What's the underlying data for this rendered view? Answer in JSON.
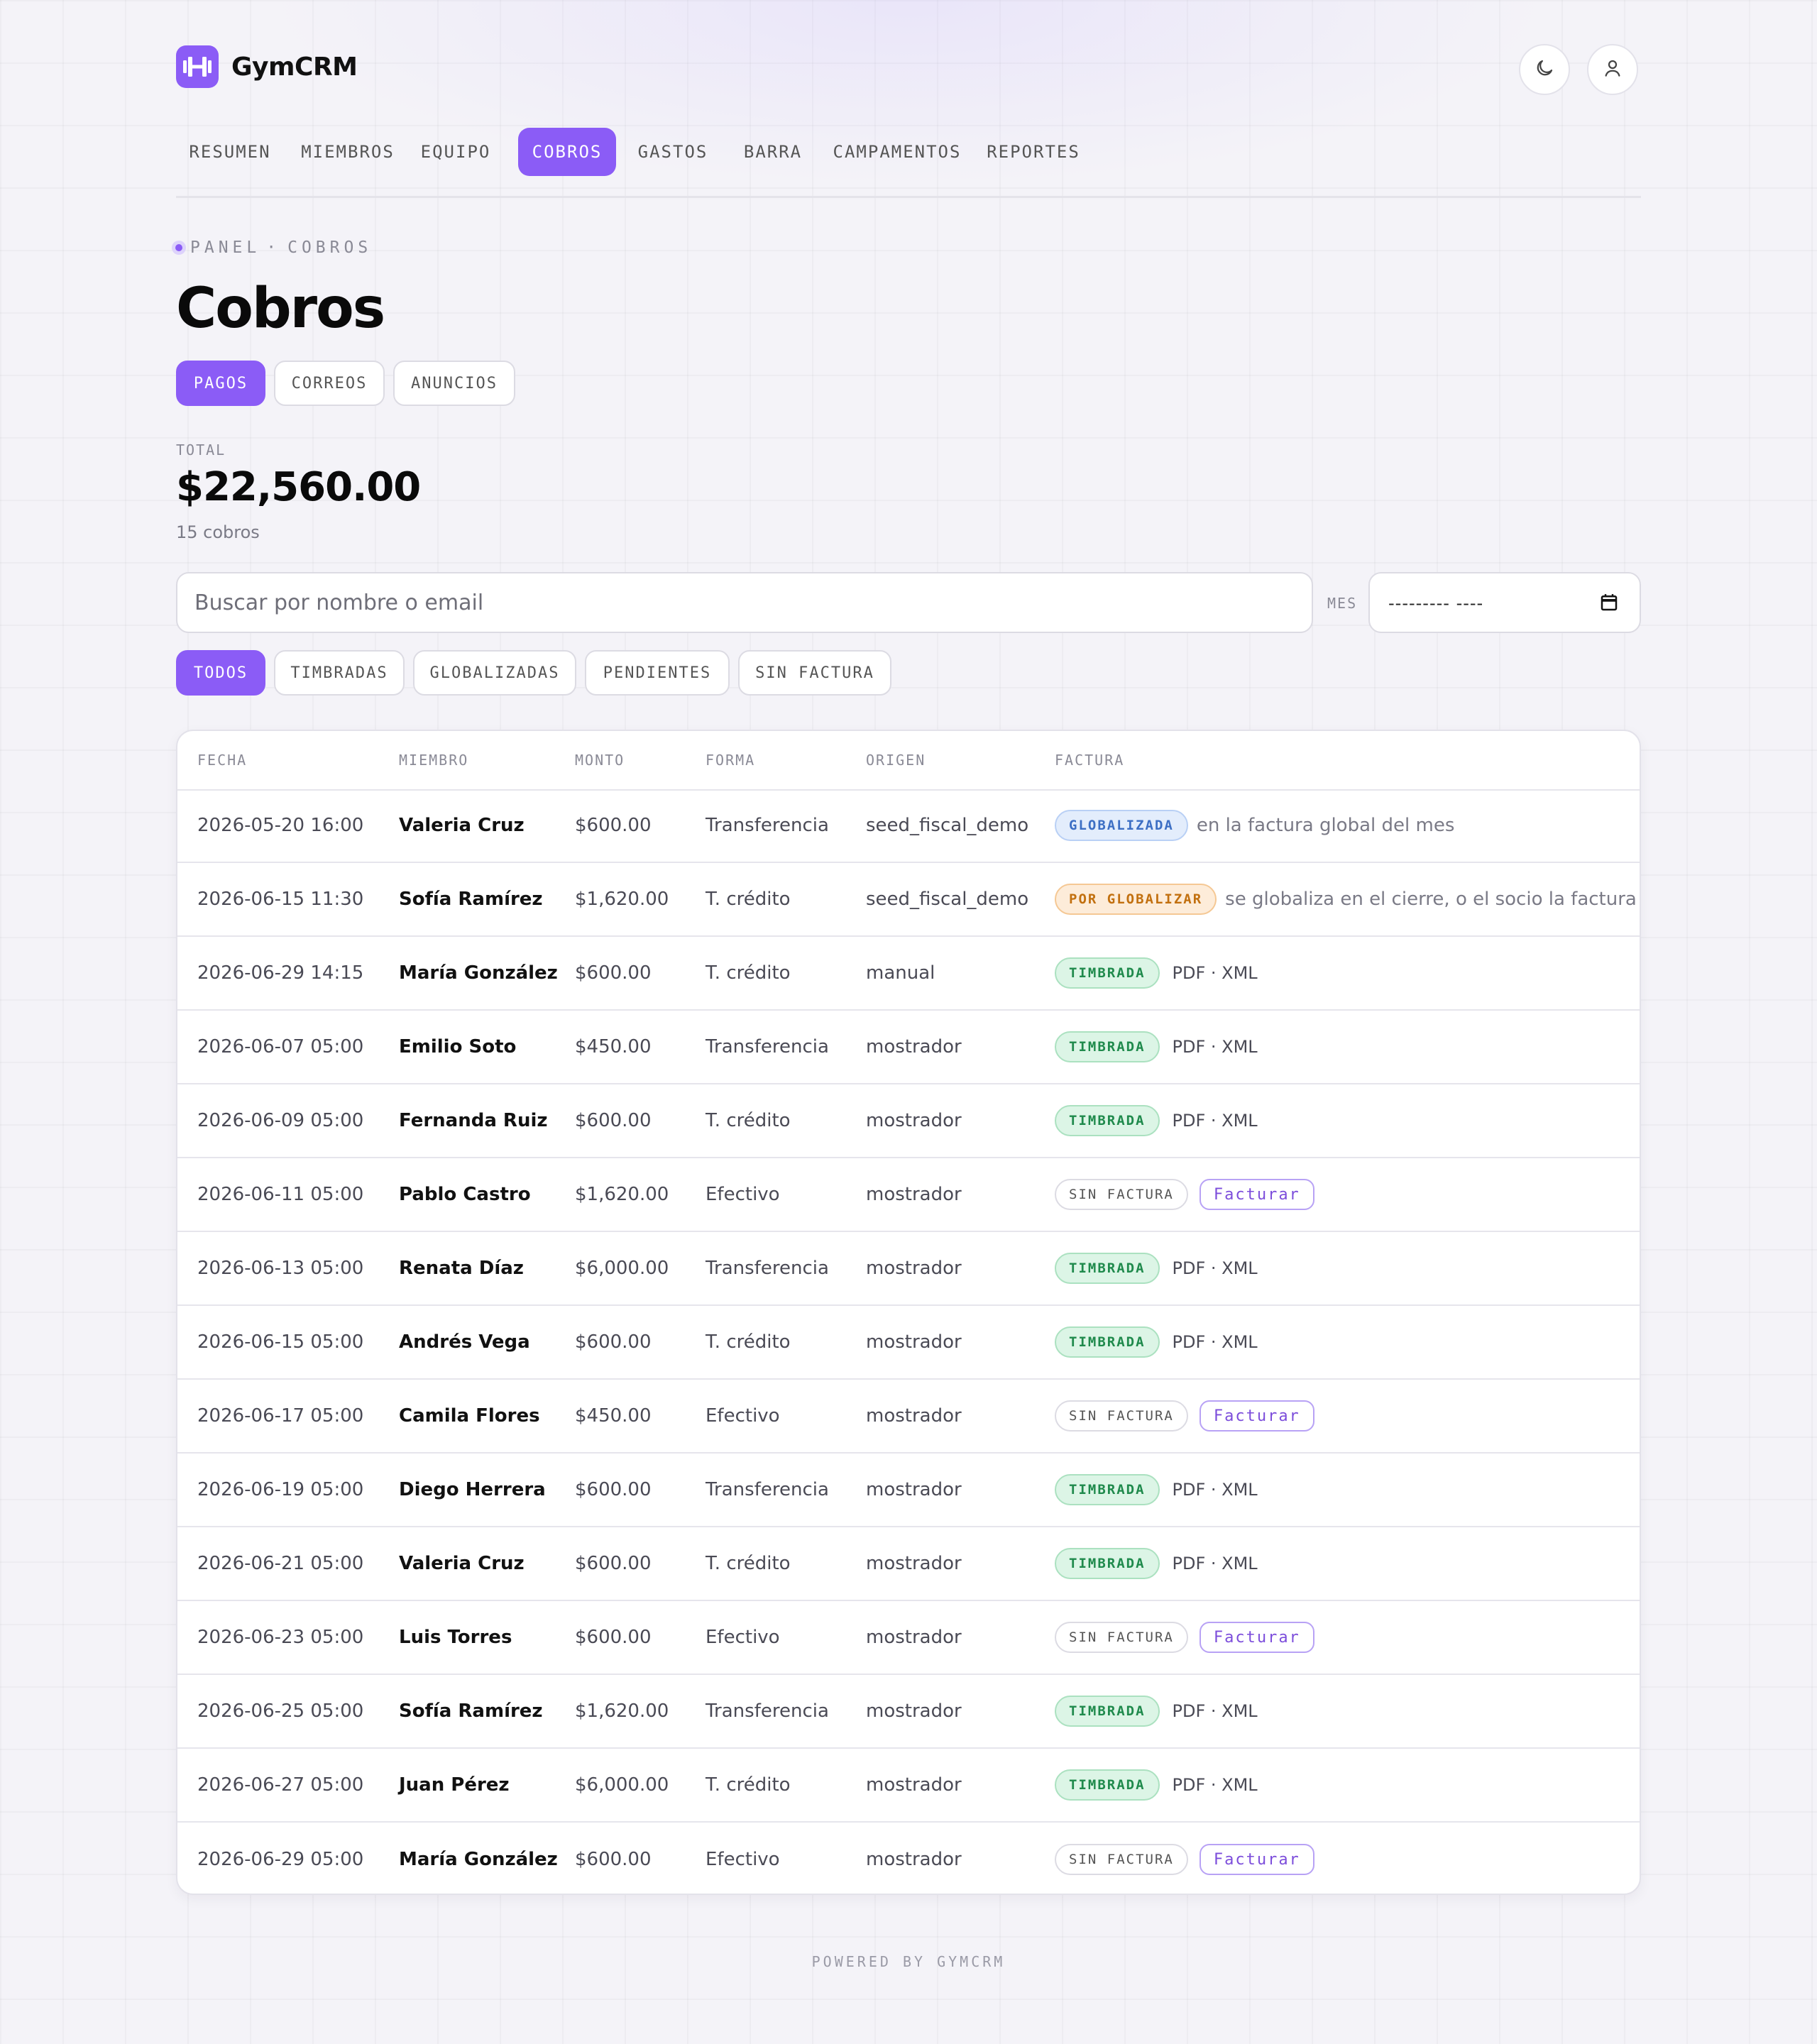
{
  "app": {
    "name": "GymCRM"
  },
  "header": {
    "theme_icon": "moon-icon",
    "user_icon": "user-icon"
  },
  "nav": {
    "items": [
      "RESUMEN",
      "MIEMBROS",
      "EQUIPO",
      "COBROS",
      "GASTOS",
      "BARRA",
      "CAMPAMENTOS",
      "REPORTES"
    ],
    "active": "COBROS"
  },
  "breadcrumb": {
    "root": "PANEL",
    "separator": "·",
    "current": "COBROS"
  },
  "page": {
    "title": "Cobros"
  },
  "subtabs": {
    "items": [
      "PAGOS",
      "CORREOS",
      "ANUNCIOS"
    ],
    "active": "PAGOS"
  },
  "summary": {
    "label": "TOTAL",
    "value": "$22,560.00",
    "count": "15 cobros"
  },
  "search": {
    "placeholder": "Buscar por nombre o email",
    "value": ""
  },
  "month": {
    "label": "MES",
    "value": "--------- ----"
  },
  "filters": {
    "items": [
      "TODOS",
      "TIMBRADAS",
      "GLOBALIZADAS",
      "PENDIENTES",
      "SIN FACTURA"
    ],
    "active": "TODOS"
  },
  "table": {
    "columns": [
      "FECHA",
      "MIEMBRO",
      "MONTO",
      "FORMA",
      "ORIGEN",
      "FACTURA"
    ],
    "rows": [
      {
        "fecha": "2026-05-20 16:00",
        "miembro": "Valeria Cruz",
        "monto": "$600.00",
        "forma": "Transferencia",
        "origen": "seed_fiscal_demo",
        "status": "glob",
        "badge": "GLOBALIZADA",
        "detail": "en la factura global del mes"
      },
      {
        "fecha": "2026-06-15 11:30",
        "miembro": "Sofía Ramírez",
        "monto": "$1,620.00",
        "forma": "T. crédito",
        "origen": "seed_fiscal_demo",
        "status": "por",
        "badge": "POR GLOBALIZAR",
        "detail": "se globaliza en el cierre, o el socio la factura"
      },
      {
        "fecha": "2026-06-29 14:15",
        "miembro": "María González",
        "monto": "$600.00",
        "forma": "T. crédito",
        "origen": "manual",
        "status": "timb",
        "badge": "TIMBRADA",
        "detail": "PDF · XML"
      },
      {
        "fecha": "2026-06-07 05:00",
        "miembro": "Emilio Soto",
        "monto": "$450.00",
        "forma": "Transferencia",
        "origen": "mostrador",
        "status": "timb",
        "badge": "TIMBRADA",
        "detail": "PDF · XML"
      },
      {
        "fecha": "2026-06-09 05:00",
        "miembro": "Fernanda Ruiz",
        "monto": "$600.00",
        "forma": "T. crédito",
        "origen": "mostrador",
        "status": "timb",
        "badge": "TIMBRADA",
        "detail": "PDF · XML"
      },
      {
        "fecha": "2026-06-11 05:00",
        "miembro": "Pablo Castro",
        "monto": "$1,620.00",
        "forma": "Efectivo",
        "origen": "mostrador",
        "status": "sin",
        "badge": "SIN FACTURA",
        "detail": "Facturar"
      },
      {
        "fecha": "2026-06-13 05:00",
        "miembro": "Renata Díaz",
        "monto": "$6,000.00",
        "forma": "Transferencia",
        "origen": "mostrador",
        "status": "timb",
        "badge": "TIMBRADA",
        "detail": "PDF · XML"
      },
      {
        "fecha": "2026-06-15 05:00",
        "miembro": "Andrés Vega",
        "monto": "$600.00",
        "forma": "T. crédito",
        "origen": "mostrador",
        "status": "timb",
        "badge": "TIMBRADA",
        "detail": "PDF · XML"
      },
      {
        "fecha": "2026-06-17 05:00",
        "miembro": "Camila Flores",
        "monto": "$450.00",
        "forma": "Efectivo",
        "origen": "mostrador",
        "status": "sin",
        "badge": "SIN FACTURA",
        "detail": "Facturar"
      },
      {
        "fecha": "2026-06-19 05:00",
        "miembro": "Diego Herrera",
        "monto": "$600.00",
        "forma": "Transferencia",
        "origen": "mostrador",
        "status": "timb",
        "badge": "TIMBRADA",
        "detail": "PDF · XML"
      },
      {
        "fecha": "2026-06-21 05:00",
        "miembro": "Valeria Cruz",
        "monto": "$600.00",
        "forma": "T. crédito",
        "origen": "mostrador",
        "status": "timb",
        "badge": "TIMBRADA",
        "detail": "PDF · XML"
      },
      {
        "fecha": "2026-06-23 05:00",
        "miembro": "Luis Torres",
        "monto": "$600.00",
        "forma": "Efectivo",
        "origen": "mostrador",
        "status": "sin",
        "badge": "SIN FACTURA",
        "detail": "Facturar"
      },
      {
        "fecha": "2026-06-25 05:00",
        "miembro": "Sofía Ramírez",
        "monto": "$1,620.00",
        "forma": "Transferencia",
        "origen": "mostrador",
        "status": "timb",
        "badge": "TIMBRADA",
        "detail": "PDF · XML"
      },
      {
        "fecha": "2026-06-27 05:00",
        "miembro": "Juan Pérez",
        "monto": "$6,000.00",
        "forma": "T. crédito",
        "origen": "mostrador",
        "status": "timb",
        "badge": "TIMBRADA",
        "detail": "PDF · XML"
      },
      {
        "fecha": "2026-06-29 05:00",
        "miembro": "María González",
        "monto": "$600.00",
        "forma": "Efectivo",
        "origen": "mostrador",
        "status": "sin",
        "badge": "SIN FACTURA",
        "detail": "Facturar"
      }
    ]
  },
  "footer": {
    "text": "POWERED BY GYMCRM"
  },
  "colors": {
    "accent": "#8b5cf6",
    "success": "#1f8a4c",
    "warning": "#c2700f",
    "info": "#3d6fc4"
  }
}
